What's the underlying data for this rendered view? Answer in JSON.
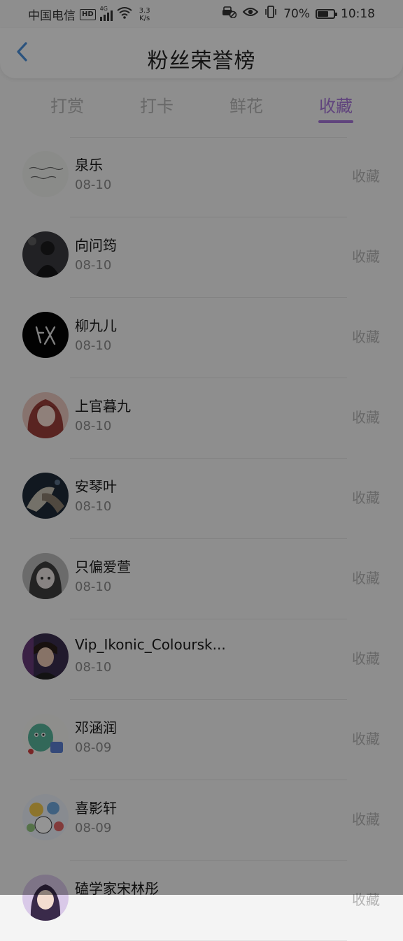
{
  "status_bar": {
    "carrier": "中国电信",
    "network_type": "4G",
    "hd": "HD",
    "net_speed_value": "3.3",
    "net_speed_unit": "K/s",
    "battery_text": "70%",
    "battery_level": 0.7,
    "time": "10:18"
  },
  "header": {
    "title": "粉丝荣誉榜"
  },
  "tabs": [
    {
      "label": "打赏",
      "active": false
    },
    {
      "label": "打卡",
      "active": false
    },
    {
      "label": "鲜花",
      "active": false
    },
    {
      "label": "收藏",
      "active": true
    }
  ],
  "list": [
    {
      "name": "泉乐",
      "date": "08-10",
      "action": "收藏"
    },
    {
      "name": "向问筠",
      "date": "08-10",
      "action": "收藏"
    },
    {
      "name": "柳九儿",
      "date": "08-10",
      "action": "收藏"
    },
    {
      "name": "上官暮九",
      "date": "08-10",
      "action": "收藏"
    },
    {
      "name": "安琴叶",
      "date": "08-10",
      "action": "收藏"
    },
    {
      "name": "只偏爱萱",
      "date": "08-10",
      "action": "收藏"
    },
    {
      "name": "Vip_Ikonic_Coloursk...",
      "date": "08-10",
      "action": "收藏"
    },
    {
      "name": "邓涵润",
      "date": "08-09",
      "action": "收藏"
    },
    {
      "name": "喜影轩",
      "date": "08-09",
      "action": "收藏"
    },
    {
      "name": "磕学家宋林彤",
      "date": "",
      "action": "收藏"
    }
  ],
  "colors": {
    "accent": "#a575d8",
    "back_arrow": "#4a90d9",
    "muted": "#b3b3b3"
  }
}
